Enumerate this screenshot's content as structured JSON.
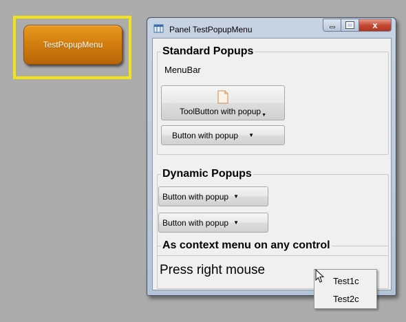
{
  "launcher": {
    "label": "TestPopupMenu"
  },
  "window": {
    "title": "Panel TestPopupMenu",
    "close_glyph": "x"
  },
  "groups": {
    "standard": {
      "title": "Standard Popups",
      "menubar_label": "MenuBar",
      "toolbutton_label": "ToolButton with popup",
      "button_label": "Button with popup"
    },
    "dynamic": {
      "title": "Dynamic Popups",
      "button1_label": "Button with popup",
      "button2_label": "Button with popup"
    },
    "context": {
      "title": "As context menu on any control",
      "press_text": "Press right mouse"
    }
  },
  "popup_menu": {
    "items": [
      "Test1c",
      "Test2c"
    ]
  },
  "glyphs": {
    "dropdown_caret": "▼"
  },
  "icons": {
    "title": "panel-icon",
    "toolbutton": "document-icon",
    "pointer": "mouse-cursor-icon"
  },
  "colors": {
    "desktop": "#acacac",
    "highlight_frame": "#f2e313",
    "launcher_button": "#cf7a0d",
    "close_button": "#c3462f"
  }
}
